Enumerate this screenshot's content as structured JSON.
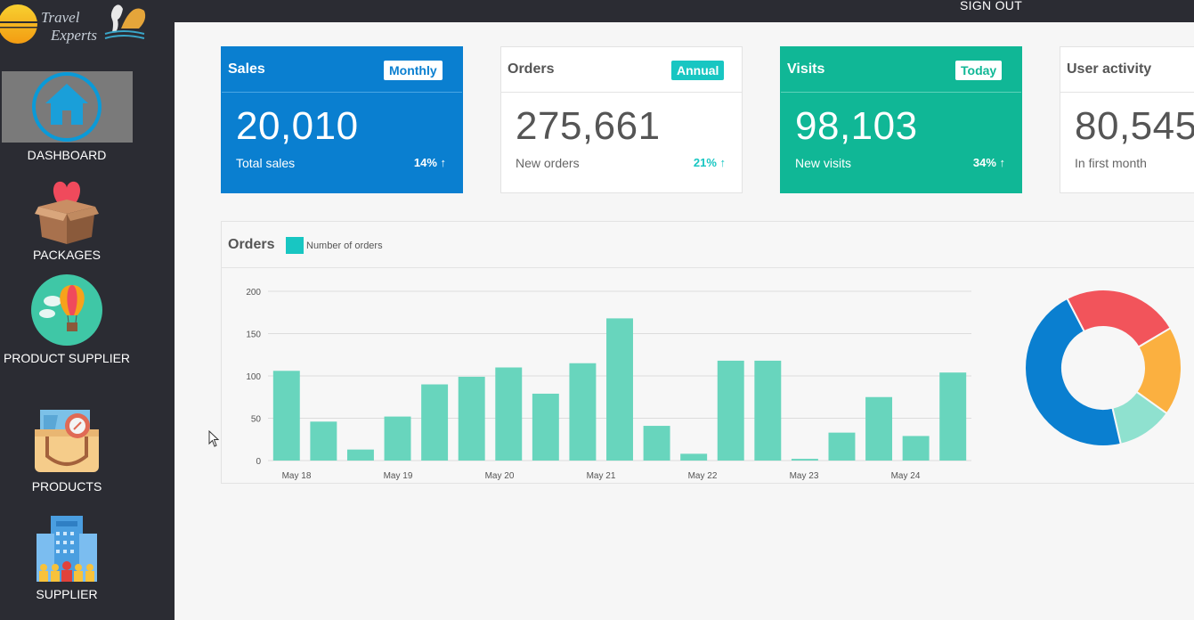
{
  "app": {
    "logo_line1": "Travel",
    "logo_line2": "Experts",
    "sign_out": "SIGN OUT"
  },
  "sidebar": {
    "items": [
      {
        "label": "DASHBOARD",
        "icon": "home-icon",
        "active": true
      },
      {
        "label": "PACKAGES",
        "icon": "gift-box-heart-icon"
      },
      {
        "label": "PRODUCT SUPPLIER",
        "icon": "hot-air-balloon-icon"
      },
      {
        "label": "PRODUCTS",
        "icon": "travel-bag-compass-icon"
      },
      {
        "label": "SUPPLIER",
        "icon": "building-people-icon"
      }
    ]
  },
  "cards": [
    {
      "title": "Sales",
      "badge": "Monthly",
      "value": "20,010",
      "subtitle": "Total sales",
      "percent": "14% ↑",
      "color": "#0a7fd0"
    },
    {
      "title": "Orders",
      "badge": "Annual",
      "value": "275,661",
      "subtitle": "New orders",
      "percent": "21% ↑",
      "color": "#ffffff"
    },
    {
      "title": "Visits",
      "badge": "Today",
      "value": "98,103",
      "subtitle": "New visits",
      "percent": "34% ↑",
      "color": "#10b796"
    },
    {
      "title": "User activity",
      "value": "80,545",
      "subtitle": "In first month",
      "color": "#ffffff"
    }
  ],
  "orders_panel": {
    "title": "Orders",
    "legend_label": "Number of orders"
  },
  "chart_data": [
    {
      "type": "bar",
      "series": [
        {
          "name": "Number of orders",
          "color": "#68d5bd",
          "values": [
            106,
            46,
            13,
            52,
            90,
            99,
            110,
            79,
            115,
            168,
            41,
            8,
            118,
            118,
            2,
            33,
            75,
            29,
            104
          ]
        }
      ],
      "x_tick_labels": [
        "May 18",
        "May 19",
        "May 20",
        "May 21",
        "May 22",
        "May 23",
        "May 24"
      ],
      "y_ticks": [
        0,
        50,
        100,
        150,
        200
      ],
      "ylim": [
        0,
        200
      ],
      "grid": true
    },
    {
      "type": "pie",
      "donut": true,
      "slices": [
        {
          "value": 21,
          "color": "#f2545b"
        },
        {
          "value": 16,
          "color": "#fbb040"
        },
        {
          "value": 10,
          "color": "#8fe1cf"
        },
        {
          "value": 40,
          "color": "#0a7fd0"
        }
      ]
    }
  ],
  "colors": {
    "sidebar_bg": "#2b2c33",
    "blue": "#0a7fd0",
    "green": "#10b796",
    "teal_badge": "#18c6c2",
    "bar": "#68d5bd"
  }
}
